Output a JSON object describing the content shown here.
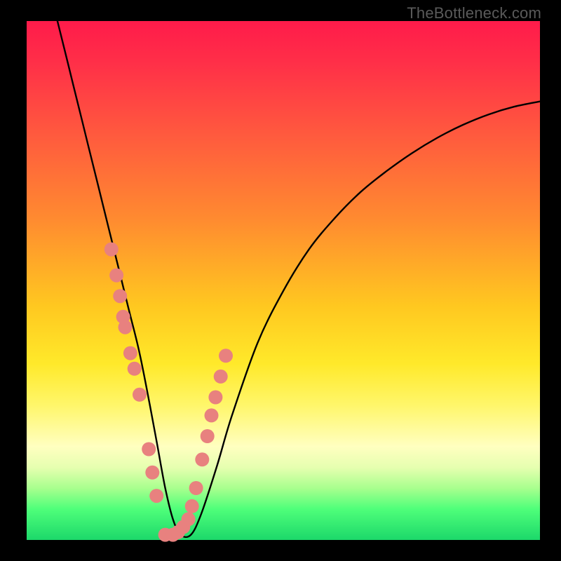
{
  "watermark": "TheBottleneck.com",
  "chart_data": {
    "type": "line",
    "title": "",
    "xlabel": "",
    "ylabel": "",
    "xlim": [
      0,
      100
    ],
    "ylim": [
      0,
      100
    ],
    "series": [
      {
        "name": "bottleneck-curve",
        "x": [
          6,
          8,
          10,
          12,
          14,
          16,
          18,
          20,
          22,
          24,
          25.5,
          27,
          28.5,
          30,
          32,
          34,
          37,
          40,
          45,
          50,
          55,
          60,
          65,
          70,
          75,
          80,
          85,
          90,
          95,
          100
        ],
        "y": [
          100,
          92,
          84,
          76,
          68,
          60,
          52,
          44,
          36,
          26,
          18,
          10,
          4,
          1,
          1,
          5,
          14,
          24,
          38,
          48,
          56,
          62,
          67,
          71,
          74.5,
          77.5,
          80,
          82,
          83.5,
          84.5
        ]
      }
    ],
    "markers": {
      "name": "highlight-dots",
      "x": [
        16.5,
        17.5,
        18.2,
        18.8,
        19.2,
        20.2,
        21.0,
        22.0,
        23.8,
        24.5,
        25.3,
        27.0,
        28.5,
        29.5,
        30.5,
        31.5,
        32.2,
        33.0,
        34.2,
        35.2,
        36.0,
        36.8,
        37.8,
        38.8
      ],
      "y": [
        56.0,
        51.0,
        47.0,
        43.0,
        41.0,
        36.0,
        33.0,
        28.0,
        17.5,
        13.0,
        8.5,
        1.0,
        1.0,
        1.5,
        2.5,
        4.0,
        6.5,
        10.0,
        15.5,
        20.0,
        24.0,
        27.5,
        31.5,
        35.5
      ],
      "color": "#e8817f",
      "radius": 10
    },
    "gradient_stops": [
      {
        "pos": 0,
        "color": "#ff1b4a"
      },
      {
        "pos": 22,
        "color": "#ff5a3e"
      },
      {
        "pos": 55,
        "color": "#ffc820"
      },
      {
        "pos": 82,
        "color": "#ffffc0"
      },
      {
        "pos": 100,
        "color": "#1cd86a"
      }
    ]
  }
}
